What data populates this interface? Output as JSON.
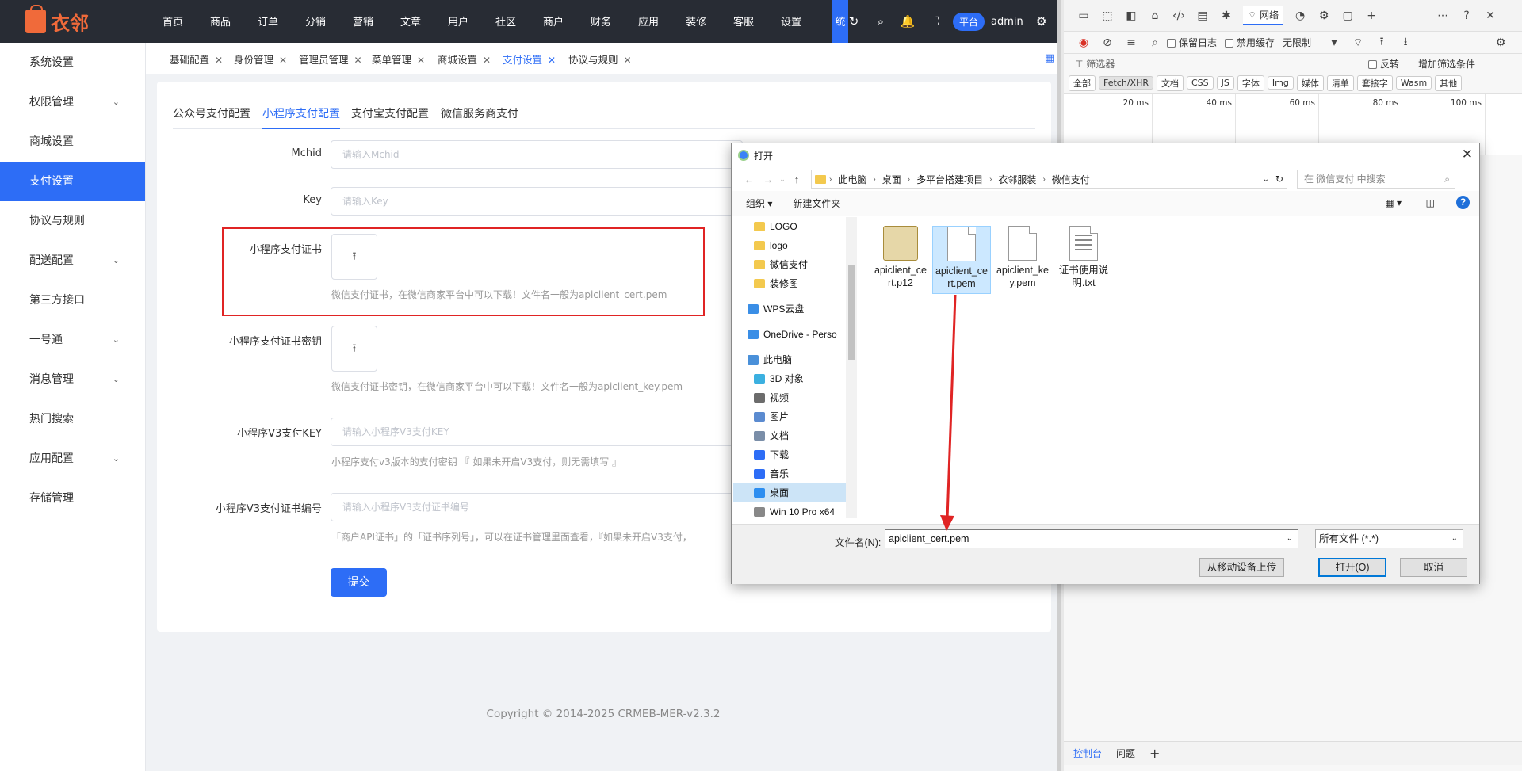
{
  "logo": {
    "text": "衣邻"
  },
  "topnav": [
    "首页",
    "商品",
    "订单",
    "分销",
    "营销",
    "文章",
    "用户",
    "社区",
    "商户",
    "财务",
    "应用",
    "装修",
    "客服",
    "设置",
    "统"
  ],
  "header": {
    "platform_label": "平台",
    "user": "admin"
  },
  "sidebar": {
    "items": [
      {
        "label": "系统设置",
        "expand": false
      },
      {
        "label": "权限管理",
        "expand": true
      },
      {
        "label": "商城设置",
        "expand": false
      },
      {
        "label": "支付设置",
        "expand": false,
        "active": true
      },
      {
        "label": "协议与规则",
        "expand": false
      },
      {
        "label": "配送配置",
        "expand": true
      },
      {
        "label": "第三方接口",
        "expand": false
      },
      {
        "label": "一号通",
        "expand": true
      },
      {
        "label": "消息管理",
        "expand": true
      },
      {
        "label": "热门搜索",
        "expand": false
      },
      {
        "label": "应用配置",
        "expand": true
      },
      {
        "label": "存储管理",
        "expand": false
      }
    ]
  },
  "tabs": [
    "基础配置",
    "身份管理",
    "管理员管理",
    "菜单管理",
    "商城设置",
    "支付设置",
    "协议与规则"
  ],
  "active_tab": "支付设置",
  "subtabs": [
    "公众号支付配置",
    "小程序支付配置",
    "支付宝支付配置",
    "微信服务商支付"
  ],
  "active_subtab": "小程序支付配置",
  "form": {
    "mchid": {
      "label": "Mchid",
      "placeholder": "请输入Mchid"
    },
    "key": {
      "label": "Key",
      "placeholder": "请输入Key"
    },
    "cert": {
      "label": "小程序支付证书",
      "hint": "微信支付证书，在微信商家平台中可以下载！文件名一般为apiclient_cert.pem"
    },
    "cert_key": {
      "label": "小程序支付证书密钥",
      "hint": "微信支付证书密钥，在微信商家平台中可以下载！文件名一般为apiclient_key.pem"
    },
    "v3key": {
      "label": "小程序V3支付KEY",
      "placeholder": "请输入小程序V3支付KEY",
      "hint": "小程序支付v3版本的支付密钥 『 如果未开启V3支付，则无需填写 』"
    },
    "v3serial": {
      "label": "小程序V3支付证书编号",
      "placeholder": "请输入小程序V3支付证书编号",
      "hint": "「商户API证书」的「证书序列号」，可以在证书管理里面查看，『如果未开启V3支付，"
    },
    "submit_label": "提交"
  },
  "copyright": "Copyright © 2014-2025 CRMEB-MER-v2.3.2",
  "devtools": {
    "network_label": "网络",
    "preserve_log": "保留日志",
    "disable_cache": "禁用缓存",
    "throttle": "无限制",
    "filter_placeholder": "筛选器",
    "invert": "反转",
    "more_filters": "增加筛选条件",
    "filters": [
      "全部",
      "Fetch/XHR",
      "文档",
      "CSS",
      "JS",
      "字体",
      "Img",
      "媒体",
      "清单",
      "套接字",
      "Wasm",
      "其他"
    ],
    "active_filter": "Fetch/XHR",
    "ticks": [
      "20 ms",
      "40 ms",
      "60 ms",
      "80 ms",
      "100 ms"
    ],
    "bottom_tabs": [
      "控制台",
      "问题"
    ]
  },
  "dialog": {
    "title": "打开",
    "breadcrumbs": [
      "此电脑",
      "桌面",
      "多平台搭建项目",
      "衣邻服装",
      "微信支付"
    ],
    "search_placeholder": "在 微信支付 中搜索",
    "organize": "组织",
    "new_folder": "新建文件夹",
    "nav": [
      {
        "label": "LOGO",
        "icon": "folder-icon"
      },
      {
        "label": "logo",
        "icon": "folder-icon"
      },
      {
        "label": "微信支付",
        "icon": "folder-icon"
      },
      {
        "label": "装修图",
        "icon": "folder-icon"
      },
      {
        "label": "",
        "icon": ""
      },
      {
        "label": "WPS云盘",
        "icon": "cloud-icon"
      },
      {
        "label": "",
        "icon": ""
      },
      {
        "label": "OneDrive - Perso",
        "icon": "cloud-icon"
      },
      {
        "label": "",
        "icon": ""
      },
      {
        "label": "此电脑",
        "icon": "computer-icon"
      },
      {
        "label": "3D 对象",
        "icon": "3d-icon"
      },
      {
        "label": "视频",
        "icon": "video-icon"
      },
      {
        "label": "图片",
        "icon": "image-icon"
      },
      {
        "label": "文档",
        "icon": "document-icon"
      },
      {
        "label": "下载",
        "icon": "download-icon"
      },
      {
        "label": "音乐",
        "icon": "music-icon"
      },
      {
        "label": "桌面",
        "icon": "desktop-icon",
        "selected": true
      },
      {
        "label": "Win 10 Pro x64",
        "icon": "drive-icon"
      }
    ],
    "files": [
      {
        "name": "apiclient_cert.p12",
        "type": "cert"
      },
      {
        "name": "apiclient_cert.pem",
        "type": "doc",
        "selected": true
      },
      {
        "name": "apiclient_key.pem",
        "type": "doc"
      },
      {
        "name": "证书使用说明.txt",
        "type": "txt"
      }
    ],
    "filename_label": "文件名(N):",
    "filename_value": "apiclient_cert.pem",
    "filetype": "所有文件 (*.*)",
    "btn_mobile": "从移动设备上传",
    "btn_open": "打开(O)",
    "btn_cancel": "取消"
  },
  "colors": {
    "primary": "#2d6df6",
    "header": "#282c34",
    "highlight_box": "#e02424",
    "arrow": "#e02424"
  }
}
